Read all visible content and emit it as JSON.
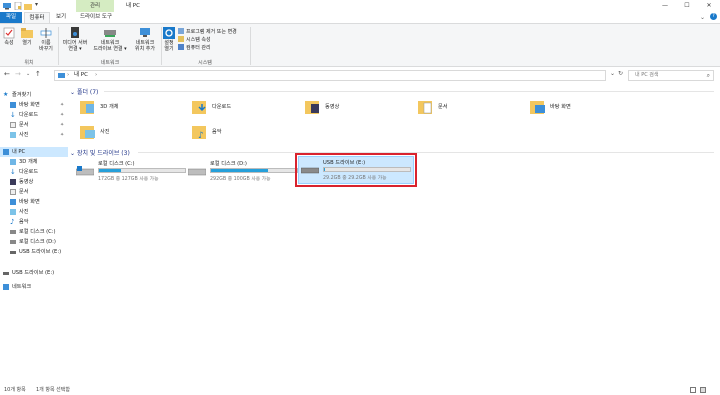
{
  "titlebar": {
    "context_tab": "관리",
    "title": "내 PC",
    "min": "—",
    "max": "☐",
    "close": "✕"
  },
  "ribbon_tabs": {
    "file": "파일",
    "computer": "컴퓨터",
    "view": "보기",
    "drive_tools": "드라이브 도구"
  },
  "ribbon": {
    "properties": "속성",
    "open": "열기",
    "rename_l1": "이름",
    "rename_l2": "바꾸기",
    "media_l1": "미디어 서버",
    "media_l2": "연결 ▾",
    "mapdrive_l1": "네트워크",
    "mapdrive_l2": "드라이브 연결 ▾",
    "addnet_l1": "네트워크",
    "addnet_l2": "위치 추가",
    "settings_l1": "설정",
    "settings_l2": "열기",
    "uninstall": "프로그램 제거 또는 변경",
    "sysprops": "시스템 속성",
    "manage": "컴퓨터 관리",
    "group_location": "위치",
    "group_network": "네트워크",
    "group_system": "시스템"
  },
  "nav": {
    "back": "←",
    "forward": "→",
    "recent": "⌄",
    "up": "↑",
    "path": "내 PC",
    "path_sep": "›",
    "refresh": "↻",
    "search_placeholder": "내 PC 검색"
  },
  "sidebar": {
    "quick_access": "즐겨찾기",
    "quick_items": [
      "바탕 화면",
      "다운로드",
      "문서",
      "사진"
    ],
    "this_pc": "내 PC",
    "pc_items": [
      "3D 개체",
      "다운로드",
      "동영상",
      "문서",
      "바탕 화면",
      "사진",
      "음악",
      "로컬 디스크 (C:)",
      "로컬 디스크 (D:)",
      "USB 드라이브 (E:)"
    ],
    "usb": "USB 드라이브 (E:)",
    "network": "네트워크"
  },
  "folders_section": "폴더 (7)",
  "folders": [
    "3D 개체",
    "다운로드",
    "동영상",
    "문서",
    "바탕 화면",
    "사진",
    "음악"
  ],
  "drives_section": "장치 및 드라이브 (3)",
  "drives": [
    {
      "name": "로컬 디스크 (C:)",
      "free": "172GB 중 127GB 사용 가능",
      "used_fraction": 0.26
    },
    {
      "name": "로컬 디스크 (D:)",
      "free": "292GB 중 100GB 사용 가능",
      "used_fraction": 0.66
    },
    {
      "name": "USB 드라이브 (E:)",
      "free": "29.2GB 중 29.2GB 사용 가능",
      "used_fraction": 0.01
    }
  ],
  "status": {
    "items": "10개 항목",
    "selected": "1개 항목 선택함"
  },
  "colors": {
    "accent": "#1979ca",
    "selection": "#cce8ff",
    "highlight_box": "#d9232e",
    "bar": "#26a0da"
  }
}
